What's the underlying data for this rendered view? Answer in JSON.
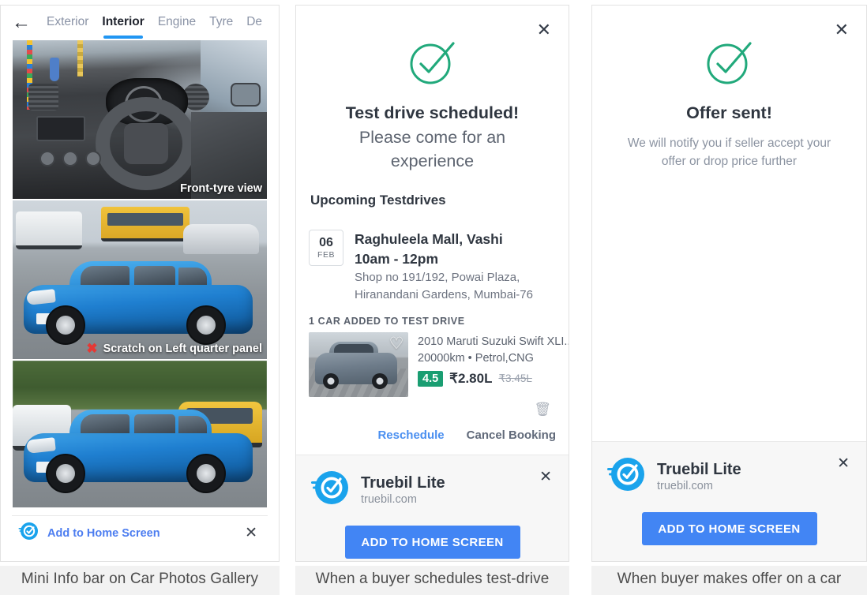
{
  "panels": [
    {
      "caption": "Mini Info bar on Car Photos Gallery",
      "gallery": {
        "back_icon": "back-arrow-icon",
        "tabs": [
          {
            "label": "Exterior",
            "active": false
          },
          {
            "label": "Interior",
            "active": true
          },
          {
            "label": "Engine",
            "active": false
          },
          {
            "label": "Tyre",
            "active": false
          },
          {
            "label": "De",
            "active": false
          }
        ],
        "photos": [
          {
            "label": "Front-tyre view",
            "has_x": false,
            "alt": "car-interior-dashboard-steering-wheel"
          },
          {
            "label": "Scratch on Left quarter panel",
            "has_x": true,
            "alt": "blue-hatchback-parking-lot"
          },
          {
            "label": "",
            "has_x": false,
            "alt": "blue-hatchback-roadside"
          }
        ],
        "minibar": {
          "logo": "truebil-logo-icon",
          "label": "Add to Home Screen",
          "close_icon": "close-icon"
        }
      }
    },
    {
      "caption": "When a buyer schedules test-drive",
      "dialog": {
        "close_icon": "close-icon",
        "check_icon": "green-check-circle-icon",
        "headline_bold": "Test drive scheduled!",
        "headline_rest": " Please come for an experience",
        "section_title": "Upcoming Testdrives",
        "booking": {
          "day": "06",
          "month": "FEB",
          "venue": "Raghuleela Mall, Vashi",
          "slot": "10am - 12pm",
          "address_line1": "Shop no 191/192, Powai Plaza,",
          "address_line2": "Hiranandani Gardens, Mumbai-76"
        },
        "cars_label": "1 CAR ADDED TO TEST DRIVE",
        "car": {
          "title": "2010 Maruti Suzuki Swift XLI...",
          "specs": "20000km • Petrol,CNG",
          "rating": "4.5",
          "price": "₹2.80L",
          "old_price": "₹3.45L",
          "favourite_icon": "heart-icon",
          "delete_icon": "trash-icon"
        },
        "actions": [
          {
            "label": "Reschedule",
            "style": "link"
          },
          {
            "label": "Cancel Booking",
            "style": "dark"
          }
        ]
      },
      "promo": {
        "logo": "truebil-logo-icon",
        "title": "Truebil Lite",
        "subtitle": "truebil.com",
        "close_icon": "close-icon",
        "cta": "ADD TO HOME SCREEN"
      }
    },
    {
      "caption": "When buyer makes offer on a car",
      "dialog": {
        "close_icon": "close-icon",
        "check_icon": "green-check-circle-icon",
        "headline_bold": "Offer sent!",
        "subline_line1": "We will notify you if seller accept your",
        "subline_line2": "offer or drop price further"
      },
      "promo": {
        "logo": "truebil-logo-icon",
        "title": "Truebil Lite",
        "subtitle": "truebil.com",
        "close_icon": "close-icon",
        "cta": "ADD TO HOME SCREEN"
      }
    }
  ],
  "colors": {
    "accent_blue": "#4285f4",
    "link_blue": "#4a8ff0",
    "tab_active": "#2196f3",
    "success_green": "#20a87a",
    "rating_green": "#1a9e72",
    "text_dark": "#2f3640",
    "text_muted": "#8b93a1",
    "caption_bg": "#f2f2f2",
    "promo_bg": "#f7f7f7"
  }
}
